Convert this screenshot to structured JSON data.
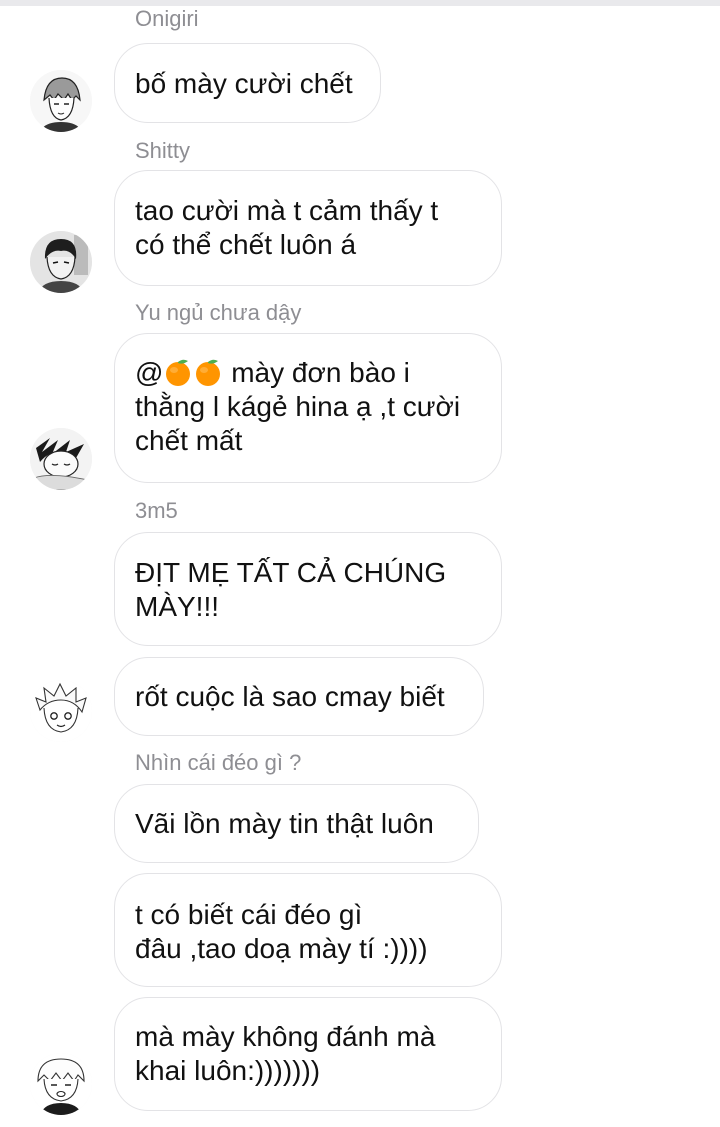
{
  "colors": {
    "bubble_border": "#e3e3e6",
    "sender_name": "#8e8e93",
    "text": "#111111"
  },
  "messages": [
    {
      "sender": "Onigiri",
      "text": "bố mày cười chết",
      "avatar": "grey-haired-boy-avatar"
    },
    {
      "sender": "Shitty",
      "text": "tao cười mà t cảm thấy t\ncó thể chết luôn á",
      "avatar": "dark-haired-boy-avatar"
    },
    {
      "sender": "Yu ngủ chưa dậy",
      "text_prefix": "@",
      "emoji": [
        "tangerine",
        "tangerine"
      ],
      "text": " mày đơn bào i\nthằng l kágẻ hina ạ ,t cười\nchết mất",
      "avatar": "sleeping-boy-avatar"
    },
    {
      "sender": "3m5",
      "text": "ĐỊT MẸ TẤT CẢ CHÚNG\nMÀY!!!",
      "avatar": ""
    },
    {
      "sender": "",
      "text": "rốt cuộc là sao cmay biết",
      "avatar": "light-haired-boy-avatar"
    },
    {
      "sender": "Nhìn cái đéo gì ?",
      "text": "Vãi lồn mày tin thật luôn",
      "avatar": ""
    },
    {
      "sender": "",
      "text": "t có biết cái đéo gì\nđâu ,tao doạ mày tí :))))",
      "avatar": ""
    },
    {
      "sender": "",
      "text": "mà mày không đánh mà\nkhai luôn:)))))))",
      "avatar": "blond-boy-avatar"
    }
  ]
}
